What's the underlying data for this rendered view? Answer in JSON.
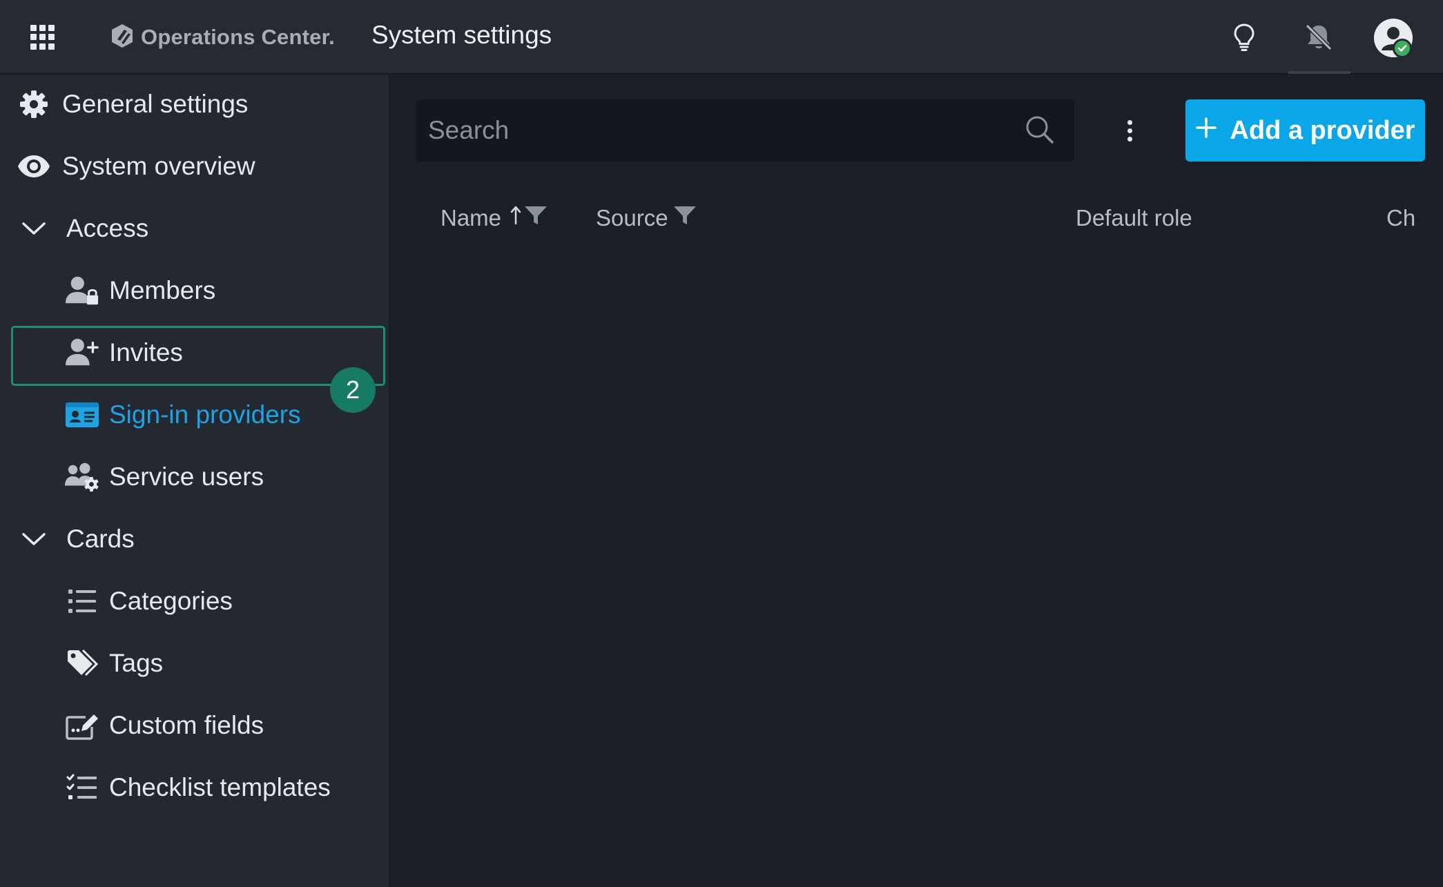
{
  "header": {
    "brand": "Operations Center.",
    "title": "System settings",
    "icons": [
      "apps-grid-icon",
      "logo-icon",
      "lightbulb-icon",
      "bell-off-icon",
      "avatar-icon"
    ]
  },
  "sidebar": {
    "items": [
      {
        "label": "General settings",
        "icon": "gear-icon"
      },
      {
        "label": "System overview",
        "icon": "eye-icon"
      },
      {
        "label": "Access",
        "icon": "chevron-down-icon"
      },
      {
        "label": "Members",
        "icon": "user-lock-icon"
      },
      {
        "label": "Invites",
        "icon": "user-plus-icon"
      },
      {
        "label": "Sign-in providers",
        "icon": "id-card-icon",
        "active": true
      },
      {
        "label": "Service users",
        "icon": "users-gear-icon"
      },
      {
        "label": "Cards",
        "icon": "chevron-down-icon"
      },
      {
        "label": "Categories",
        "icon": "list-icon"
      },
      {
        "label": "Tags",
        "icon": "tags-icon"
      },
      {
        "label": "Custom fields",
        "icon": "custom-field-icon"
      },
      {
        "label": "Checklist templates",
        "icon": "checklist-icon"
      }
    ],
    "badge": "2"
  },
  "main": {
    "search": {
      "placeholder": "Search",
      "value": ""
    },
    "add_button_label": "Add a provider",
    "columns": [
      {
        "label": "Name",
        "sort": "ascending",
        "filter": true
      },
      {
        "label": "Source",
        "filter": true
      },
      {
        "label": "Default role"
      },
      {
        "label": "Ch"
      }
    ]
  },
  "colors": {
    "accent": "#0aa7e8",
    "active_text": "#1ea4e4",
    "active_border": "#1c8f77",
    "badge": "#177a65",
    "status_online": "#3fae5c"
  }
}
